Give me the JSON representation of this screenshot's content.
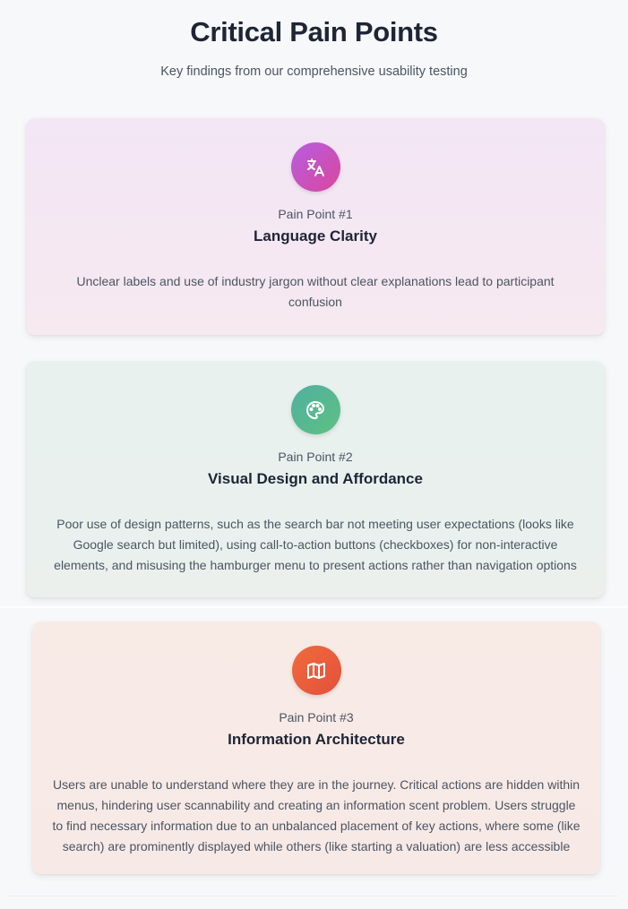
{
  "header": {
    "title": "Critical Pain Points",
    "subtitle": "Key findings from our comprehensive usability testing"
  },
  "pain_points": [
    {
      "number_label": "Pain Point #1",
      "title": "Language Clarity",
      "description": "Unclear labels and use of industry jargon without clear explanations lead to participant confusion",
      "icon": "translate-icon"
    },
    {
      "number_label": "Pain Point #2",
      "title": "Visual Design and Affordance",
      "description": "Poor use of design patterns, such as the search bar not meeting user expectations (looks like Google search but limited), using call-to-action buttons (checkboxes) for non-interactive elements, and misusing the hamburger menu to present actions rather than navigation options",
      "icon": "palette-icon"
    },
    {
      "number_label": "Pain Point #3",
      "title": "Information Architecture",
      "description": "Users are unable to understand where they are in the journey. Critical actions are hidden within menus, hindering user scannability and creating an information scent problem. Users struggle to find necessary information due to an unbalanced placement of key actions, where some (like search) are prominently displayed while others (like starting a valuation) are less accessible",
      "icon": "map-icon"
    }
  ],
  "colors": {
    "card1_icon": "#c84fc0",
    "card2_icon": "#56b891",
    "card3_icon": "#e95d3c"
  }
}
